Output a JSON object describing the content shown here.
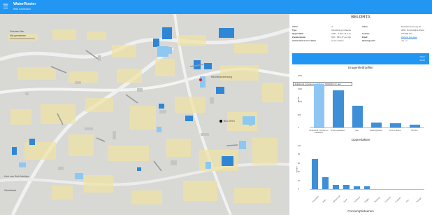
{
  "app": {
    "title": "WaterRoster",
    "subtitle": "Beta dashboard",
    "menu_icon": "menu-icon"
  },
  "map": {
    "filter_label": "Selecteer filter",
    "filter_value": "Alle gemeenten",
    "labels": {
      "belorta": "BELORTA",
      "place_1": "Zandstraat",
      "place_2": "Mechelsesteenweg",
      "place_3": "Kerk van Sint-Katelijne"
    }
  },
  "panel": {
    "title": "BELORTA",
    "left_info": [
      {
        "key": "Adres",
        "value": "nr."
      },
      {
        "key": "Type",
        "value": "Industriële grondaarde"
      },
      {
        "key": "Oppervlakte",
        "value": "3.857 - 4.827 m2 (7 h)"
      },
      {
        "key": "Zoekperimeter",
        "value": "60% - 85% 47 per dag"
      },
      {
        "key": "Aantal adressen in radius",
        "value": "zones wasken"
      }
    ],
    "right_info": [
      {
        "key": "Adres",
        "value": "Mechelsesteenweg 40"
      },
      {
        "key": "",
        "value": "2860, Sint-Katelijne-Waver"
      },
      {
        "key": "Contact",
        "value": "015 555 123"
      },
      {
        "key": "Email",
        "value": "Website bezoeken"
      },
      {
        "key": "Openingsuren",
        "value": "ma - vr"
      }
    ],
    "band_lines": [
      "Open",
      "23:00"
    ],
    "section_1": "Krugereletfrueflen",
    "section_2": "Oppervlakten",
    "section_3": "Consumpticteenen",
    "tooltip": "Enkelvoud, Grootte en variabelen: 5000000 m3 / jaar"
  },
  "chart_data": [
    {
      "type": "bar",
      "title": "Krugereletfrueflen",
      "categories": [
        "Enkelvoud, Grootte en variabelen",
        "Groep gewassen",
        "Hoo",
        "Veldoogstmeer",
        "Fruit en fleere",
        "Overbel"
      ],
      "values": [
        1680,
        1420,
        850,
        190,
        160,
        95
      ],
      "ylim": [
        0,
        2000
      ],
      "yticks": [
        "2000",
        "1500",
        "1000",
        "500",
        "0"
      ],
      "ylabel": "aantal"
    },
    {
      "type": "bar",
      "title": "Oppervlakten",
      "categories": [
        "Graanteelt",
        "Maïs",
        "Wintertarwe",
        "Gerst",
        "Tuinbouw",
        "Rogge",
        "Bosbouw",
        "Grasland",
        "Fruitteelt",
        "Vlas",
        "Overige"
      ],
      "values": [
        70,
        28,
        9,
        9,
        7,
        6,
        0,
        0,
        0,
        0,
        0
      ],
      "ylim": [
        0,
        100
      ],
      "yticks": [
        "100",
        "80",
        "60",
        "40",
        "20",
        "0"
      ],
      "ylabel": "hectare"
    }
  ]
}
